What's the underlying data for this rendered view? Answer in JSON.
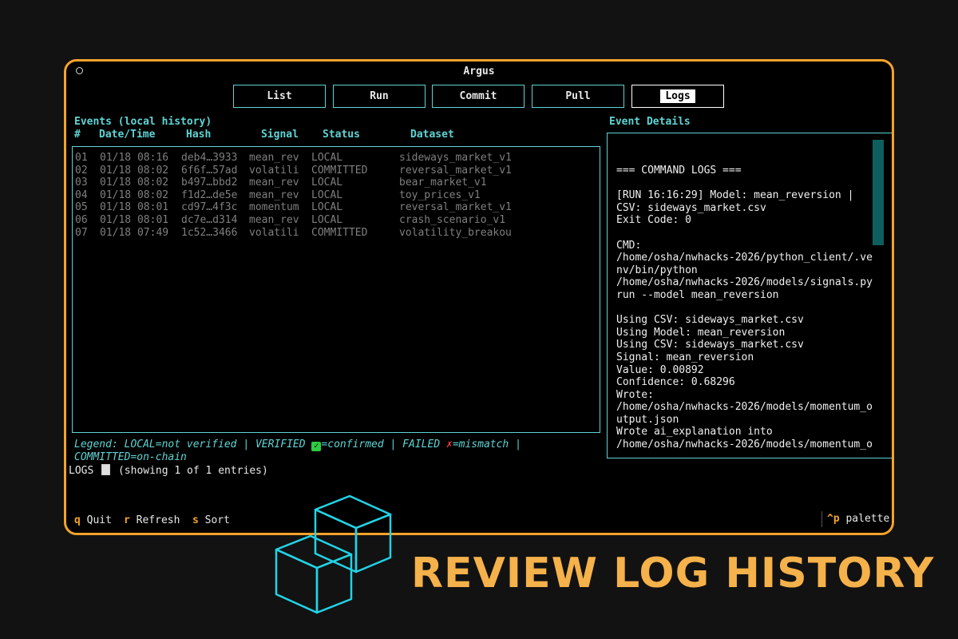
{
  "window": {
    "title": "Argus"
  },
  "tabs": [
    {
      "label": "List",
      "active": false
    },
    {
      "label": "Run",
      "active": false
    },
    {
      "label": "Commit",
      "active": false
    },
    {
      "label": "Pull",
      "active": false
    },
    {
      "label": "Logs",
      "active": true
    }
  ],
  "events": {
    "title": "Events (local history)",
    "columns": [
      "#",
      "Date/Time",
      "Hash",
      "Signal",
      "Status",
      "Dataset"
    ],
    "rows": [
      [
        "01",
        "01/18 08:16",
        "deb4…3933",
        "mean_rev",
        "LOCAL",
        "sideways_market_v1"
      ],
      [
        "02",
        "01/18 08:02",
        "6f6f…57ad",
        "volatili",
        "COMMITTED",
        "reversal_market_v1"
      ],
      [
        "03",
        "01/18 08:02",
        "b497…bbd2",
        "mean_rev",
        "LOCAL",
        "bear_market_v1"
      ],
      [
        "04",
        "01/18 08:02",
        "f1d2…de5e",
        "mean_rev",
        "LOCAL",
        "toy_prices_v1"
      ],
      [
        "05",
        "01/18 08:01",
        "cd97…4f3c",
        "momentum",
        "LOCAL",
        "reversal_market_v1"
      ],
      [
        "06",
        "01/18 08:01",
        "dc7e…d314",
        "mean_rev",
        "LOCAL",
        "crash_scenario_v1"
      ],
      [
        "07",
        "01/18 07:49",
        "1c52…3466",
        "volatili",
        "COMMITTED",
        "volatility_breakou"
      ]
    ]
  },
  "details": {
    "title": "Event Details",
    "lines": [
      "=== COMMAND LOGS ===",
      "",
      "[RUN 16:16:29] Model: mean_reversion |",
      "CSV: sideways_market.csv",
      "Exit Code: 0",
      "",
      "CMD:",
      "/home/osha/nwhacks-2026/python_client/.ve",
      "nv/bin/python",
      "/home/osha/nwhacks-2026/models/signals.py",
      "run --model mean_reversion",
      "",
      "Using CSV: sideways_market.csv",
      "Using Model: mean_reversion",
      "Using CSV: sideways_market.csv",
      "Signal: mean_reversion",
      "Value: 0.00892",
      "Confidence: 0.68296",
      "Wrote:",
      "/home/osha/nwhacks-2026/models/momentum_o",
      "utput.json",
      "Wrote ai_explanation into",
      "/home/osha/nwhacks-2026/models/momentum_o"
    ]
  },
  "legend": {
    "part1": "Legend: LOCAL=not verified | VERIFIED ",
    "confirmed": "=confirmed",
    "failed": " | FAILED ",
    "mismatch": "=mismatch",
    "end": " |",
    "line2": "COMMITTED=on-chain"
  },
  "status": {
    "prefix": "LOGS",
    "text": "(showing 1 of 1 entries)"
  },
  "footer": {
    "quit_key": "q",
    "quit_label": "Quit",
    "refresh_key": "r",
    "refresh_label": "Refresh",
    "sort_key": "s",
    "sort_label": "Sort",
    "palette_key": "^p",
    "palette_label": "palette"
  },
  "tagline": "REVIEW LOG HISTORY",
  "colors": {
    "accent": "#f5a32a",
    "cyan": "#5fd4d4",
    "tagline": "#f5b14a"
  }
}
